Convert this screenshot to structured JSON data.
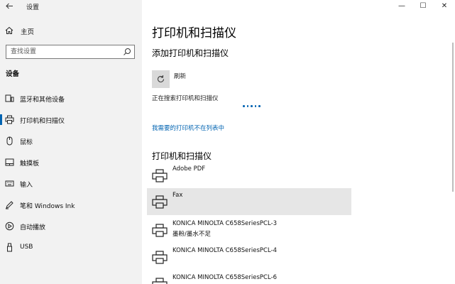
{
  "window": {
    "title": "设置",
    "controls": {
      "minimize": "—",
      "maximize": "☐",
      "close": "✕"
    }
  },
  "sidebar": {
    "home_label": "主页",
    "search_placeholder": "查找设置",
    "section_title": "设备",
    "items": [
      {
        "label": "蓝牙和其他设备",
        "icon": "bluetooth-devices-icon"
      },
      {
        "label": "打印机和扫描仪",
        "icon": "printer-icon",
        "active": true
      },
      {
        "label": "鼠标",
        "icon": "mouse-icon"
      },
      {
        "label": "触摸板",
        "icon": "touchpad-icon"
      },
      {
        "label": "输入",
        "icon": "keyboard-icon"
      },
      {
        "label": "笔和 Windows Ink",
        "icon": "pen-icon"
      },
      {
        "label": "自动播放",
        "icon": "autoplay-icon"
      },
      {
        "label": "USB",
        "icon": "usb-icon"
      }
    ]
  },
  "main": {
    "title": "打印机和扫描仪",
    "add_section_title": "添加打印机和扫描仪",
    "refresh_label": "刷新",
    "searching_text": "正在搜索打印机和扫描仪",
    "not_listed_link": "我需要的打印机不在列表中",
    "list_title": "打印机和扫描仪",
    "printers": [
      {
        "name": "Adobe PDF",
        "status": ""
      },
      {
        "name": "Fax",
        "status": "",
        "selected": true
      },
      {
        "name": "KONICA MINOLTA C658SeriesPCL-3",
        "status": "墨粉/墨水不足"
      },
      {
        "name": "KONICA MINOLTA C658SeriesPCL-4",
        "status": ""
      },
      {
        "name": "KONICA MINOLTA C658SeriesPCL-6",
        "status": ""
      }
    ]
  },
  "colors": {
    "accent": "#0063b1",
    "sidebar_bg": "#f2f2f2",
    "selected_row_bg": "#e6e6e6"
  }
}
